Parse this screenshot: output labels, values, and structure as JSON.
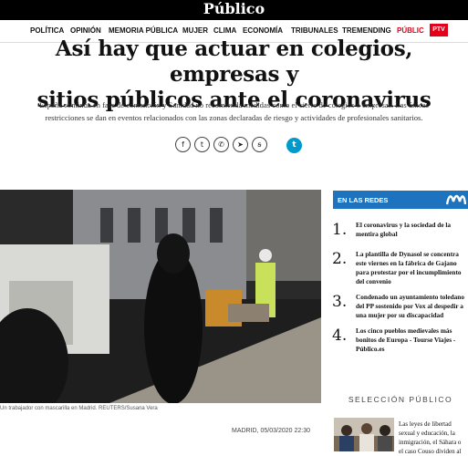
{
  "header": {
    "logo": "Público"
  },
  "nav": {
    "items": [
      "POLÍTICA",
      "OPINIÓN",
      "MEMORIA PÚBLICA",
      "MUJER",
      "CLIMA",
      "ECONOMÍA",
      "TRIBUNALES",
      "TREMENDING",
      "PÚBLIC"
    ],
    "badge": "PTV"
  },
  "article": {
    "title_line1": "Así hay que actuar en colegios, empresas y",
    "title_line2": "sitios públicos ante el coronavirus",
    "intro_line1": "España continúa en fase de contención y Sanidad no recomienda medidas como el cierre de colegios o empresas. Las únicas",
    "intro_line2": "restricciones se dan en eventos relacionados con las zonas declaradas de riesgo y actividades de profesionales sanitarios.",
    "caption": "Un trabajador con mascarilla en Madrid. REUTERS/Susana Vera",
    "dateline": "MADRID,   05/03/2020 22:30"
  },
  "share": {
    "icons": [
      "facebook-icon",
      "twitter-icon",
      "whatsapp-icon",
      "telegram-icon",
      "meneame-icon",
      "tumblr-icon"
    ],
    "glyphs": [
      "f",
      "t",
      "✆",
      "➤",
      "ꞩ",
      "t"
    ]
  },
  "sidebar": {
    "redes_title": "EN LAS REDES",
    "items": [
      {
        "num": "1.",
        "lines": [
          "El coronavirus y la sociedad de la",
          "mentira global"
        ]
      },
      {
        "num": "2.",
        "lines": [
          "La plantilla de Dynasol se concentra",
          "este viernes en la fábrica de Gajano",
          "para protestar por el incumplimiento",
          "del convenio"
        ]
      },
      {
        "num": "3.",
        "lines": [
          "Condenado un ayuntamiento toledano",
          "del PP sostenido por Vox al despedir a",
          "una mujer por su discapacidad"
        ]
      },
      {
        "num": "4.",
        "lines": [
          "Los cinco pueblos medievales más",
          "bonitos de Europa - Tourse Viajes -",
          "Público.es"
        ]
      }
    ],
    "seleccion_title": "SELECCIÓN PÚBLICO",
    "seleccion_lines": [
      "Las leyes de libertad",
      "sexual y educación, la",
      "inmigración, el Sáhara o",
      "el caso Couso dividen al"
    ]
  },
  "colors": {
    "accent_red": "#e2001a",
    "redes_blue": "#1e73be"
  }
}
